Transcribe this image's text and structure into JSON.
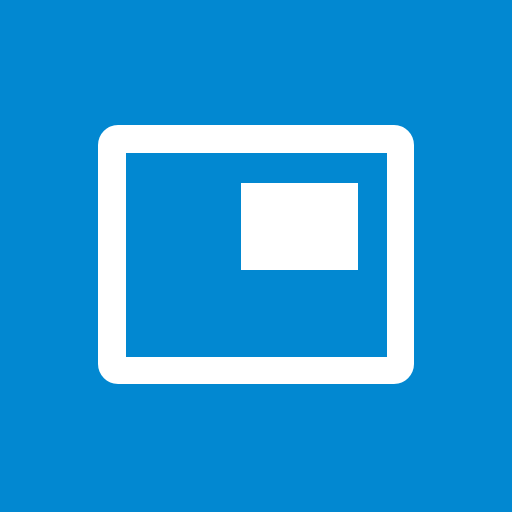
{
  "app_tile": {
    "background_color": "#0288d1",
    "icon": {
      "name": "picture-in-picture-icon",
      "color": "#ffffff"
    }
  }
}
